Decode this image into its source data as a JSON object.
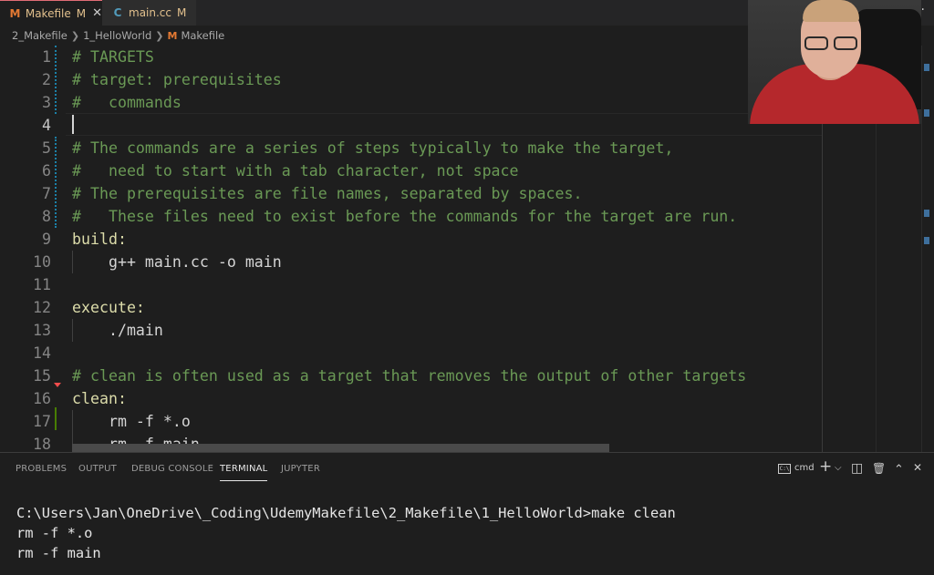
{
  "tabs": [
    {
      "icon": "M",
      "label": "Makefile",
      "modified": "M",
      "close": "✕"
    },
    {
      "icon": "C",
      "label": "main.cc",
      "modified": "M"
    }
  ],
  "more_actions": "···",
  "breadcrumb": {
    "folder1": "2_Makefile",
    "folder2": "1_HelloWorld",
    "file_icon": "M",
    "file": "Makefile"
  },
  "editor": {
    "lines": [
      {
        "num": "1",
        "text": "# TARGETS",
        "kind": "comment"
      },
      {
        "num": "2",
        "text": "# target: prerequisites",
        "kind": "comment"
      },
      {
        "num": "3",
        "text": "#   commands",
        "kind": "comment"
      },
      {
        "num": "4",
        "text": "",
        "kind": "plain"
      },
      {
        "num": "5",
        "text": "# The commands are a series of steps typically to make the target,",
        "kind": "comment"
      },
      {
        "num": "6",
        "text": "#   need to start with a tab character, not space",
        "kind": "comment"
      },
      {
        "num": "7",
        "text": "# The prerequisites are file names, separated by spaces.",
        "kind": "comment"
      },
      {
        "num": "8",
        "text": "#   These files need to exist before the commands for the target are run.",
        "kind": "comment"
      },
      {
        "num": "9",
        "text": "build:",
        "kind": "target"
      },
      {
        "num": "10",
        "text": "    g++ main.cc -o main",
        "kind": "plain"
      },
      {
        "num": "11",
        "text": "",
        "kind": "plain"
      },
      {
        "num": "12",
        "text": "execute:",
        "kind": "target"
      },
      {
        "num": "13",
        "text": "    ./main",
        "kind": "plain"
      },
      {
        "num": "14",
        "text": "",
        "kind": "plain"
      },
      {
        "num": "15",
        "text": "# clean is often used as a target that removes the output of other targets",
        "kind": "comment"
      },
      {
        "num": "16",
        "text": "clean:",
        "kind": "target"
      },
      {
        "num": "17",
        "text": "    rm -f *.o",
        "kind": "plain"
      },
      {
        "num": "18",
        "text": "    rm -f main",
        "kind": "plain"
      }
    ],
    "current_line": "4"
  },
  "panel": {
    "tabs": [
      "PROBLEMS",
      "OUTPUT",
      "DEBUG CONSOLE",
      "TERMINAL",
      "JUPYTER"
    ],
    "active_tab": "TERMINAL",
    "shell_icon_text": "C:\\",
    "shell": "cmd",
    "add_icon": "+",
    "dropdown_icon": "⌵",
    "split_icon": "◫",
    "trash_icon": "🗑",
    "maximize_icon": "⌃",
    "close_icon": "✕"
  },
  "terminal": {
    "lines": [
      "C:\\Users\\Jan\\OneDrive\\_Coding\\UdemyMakefile\\2_Makefile\\1_HelloWorld>make clean",
      "rm -f *.o",
      "rm -f main"
    ]
  },
  "colors": {
    "comment": "#6a9955",
    "target": "#dcdcaa",
    "plain": "#d4d4d4",
    "makefile_icon": "#e37933",
    "cpp_icon": "#519aba",
    "modified": "#e2c08d"
  }
}
